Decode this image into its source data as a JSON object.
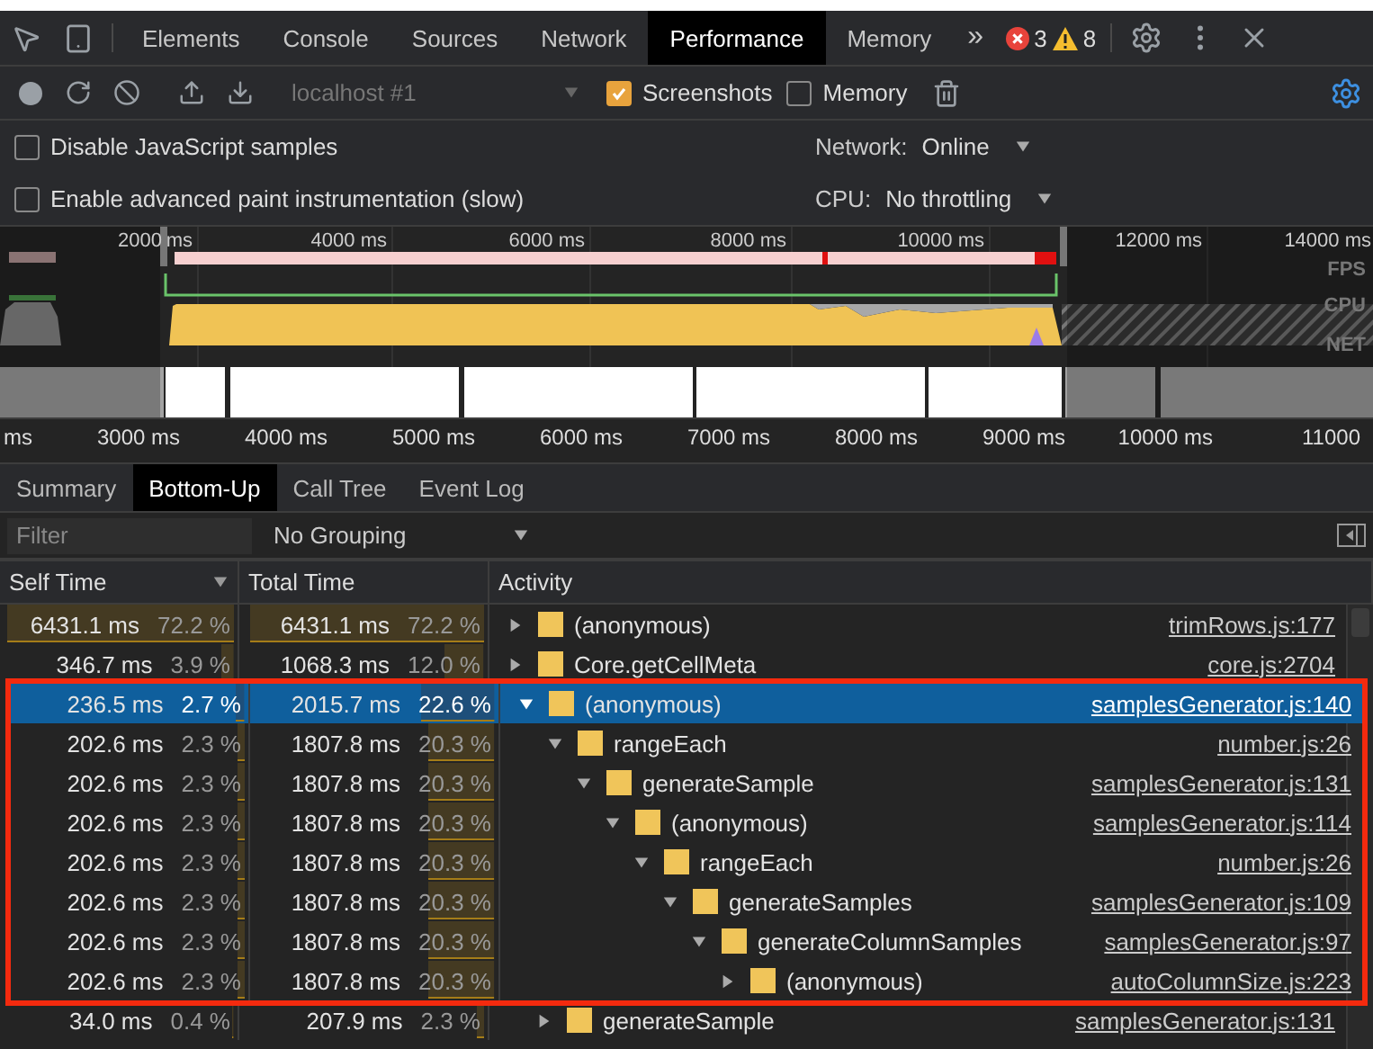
{
  "main_tabs": [
    {
      "label": "Elements",
      "selected": false
    },
    {
      "label": "Console",
      "selected": false
    },
    {
      "label": "Sources",
      "selected": false
    },
    {
      "label": "Network",
      "selected": false
    },
    {
      "label": "Performance",
      "selected": true
    },
    {
      "label": "Memory",
      "selected": false
    }
  ],
  "more_tabs": "»",
  "issues": {
    "errors": "3",
    "warnings": "8"
  },
  "toolbar": {
    "target": "localhost #1",
    "options": [
      {
        "label": "Screenshots",
        "checked": true
      },
      {
        "label": "Memory",
        "checked": false
      }
    ]
  },
  "settings": {
    "left": [
      {
        "label": "Disable JavaScript samples",
        "checked": false
      },
      {
        "label": "Enable advanced paint instrumentation (slow)",
        "checked": false
      }
    ],
    "right": [
      {
        "label": "Network:",
        "value": "Online"
      },
      {
        "label": "CPU:",
        "value": "No throttling"
      }
    ]
  },
  "overview": {
    "ruler": [
      "2000",
      "ms",
      "4000 ms",
      "6000 ms",
      "8000 ms",
      "10000 ms",
      "12000 ms",
      "14000 ms"
    ],
    "tracks": [
      "FPS",
      "CPU",
      "NET"
    ]
  },
  "timeline_ruler": [
    "ms",
    "3000 ms",
    "4000 ms",
    "5000 ms",
    "6000 ms",
    "7000 ms",
    "8000 ms",
    "9000 ms",
    "10000 ms",
    "11000"
  ],
  "detail_tabs": [
    {
      "label": "Summary",
      "selected": false
    },
    {
      "label": "Bottom-Up",
      "selected": true
    },
    {
      "label": "Call Tree",
      "selected": false
    },
    {
      "label": "Event Log",
      "selected": false
    }
  ],
  "filter": {
    "placeholder": "Filter"
  },
  "grouping": "No Grouping",
  "table": {
    "columns": [
      "Self Time",
      "Total Time",
      "Activity"
    ],
    "rows": [
      {
        "self_time": "6431.1 ms",
        "self_pct": "72.2 %",
        "total_time": "6431.1 ms",
        "total_pct": "72.2 %",
        "name": "(anonymous)",
        "source": "trimRows.js:177",
        "expanded": false,
        "selected": false,
        "highlighted": false
      },
      {
        "self_time": "346.7 ms",
        "self_pct": "3.9 %",
        "total_time": "1068.3 ms",
        "total_pct": "12.0 %",
        "name": "Core.getCellMeta",
        "source": "core.js:2704",
        "expanded": false,
        "selected": false,
        "highlighted": false
      },
      {
        "self_time": "236.5 ms",
        "self_pct": "2.7 %",
        "total_time": "2015.7 ms",
        "total_pct": "22.6 %",
        "name": "(anonymous)",
        "source": "samplesGenerator.js:140",
        "expanded": true,
        "selected": true,
        "highlighted": true,
        "children": [
          {
            "self_time": "202.6 ms",
            "self_pct": "2.3 %",
            "total_time": "1807.8 ms",
            "total_pct": "20.3 %",
            "name": "rangeEach",
            "source": "number.js:26",
            "expanded": true,
            "selected": false,
            "highlighted": true,
            "children": [
              {
                "self_time": "202.6 ms",
                "self_pct": "2.3 %",
                "total_time": "1807.8 ms",
                "total_pct": "20.3 %",
                "name": "generateSample",
                "source": "samplesGenerator.js:131",
                "expanded": true,
                "selected": false,
                "highlighted": true,
                "children": [
                  {
                    "self_time": "202.6 ms",
                    "self_pct": "2.3 %",
                    "total_time": "1807.8 ms",
                    "total_pct": "20.3 %",
                    "name": "(anonymous)",
                    "source": "samplesGenerator.js:114",
                    "expanded": true,
                    "selected": false,
                    "highlighted": true,
                    "children": [
                      {
                        "self_time": "202.6 ms",
                        "self_pct": "2.3 %",
                        "total_time": "1807.8 ms",
                        "total_pct": "20.3 %",
                        "name": "rangeEach",
                        "source": "number.js:26",
                        "expanded": true,
                        "selected": false,
                        "highlighted": true,
                        "children": [
                          {
                            "self_time": "202.6 ms",
                            "self_pct": "2.3 %",
                            "total_time": "1807.8 ms",
                            "total_pct": "20.3 %",
                            "name": "generateSamples",
                            "source": "samplesGenerator.js:109",
                            "expanded": true,
                            "selected": false,
                            "highlighted": true,
                            "children": [
                              {
                                "self_time": "202.6 ms",
                                "self_pct": "2.3 %",
                                "total_time": "1807.8 ms",
                                "total_pct": "20.3 %",
                                "name": "generateColumnSamples",
                                "source": "samplesGenerator.js:97",
                                "expanded": true,
                                "selected": false,
                                "highlighted": true,
                                "children": [
                                  {
                                    "self_time": "202.6 ms",
                                    "self_pct": "2.3 %",
                                    "total_time": "1807.8 ms",
                                    "total_pct": "20.3 %",
                                    "name": "(anonymous)",
                                    "source": "autoColumnSize.js:223",
                                    "expanded": false,
                                    "selected": false,
                                    "highlighted": true
                                  }
                                ]
                              }
                            ]
                          }
                        ]
                      }
                    ]
                  }
                ]
              }
            ]
          },
          {
            "self_time": "34.0 ms",
            "self_pct": "0.4 %",
            "total_time": "207.9 ms",
            "total_pct": "2.3 %",
            "name": "generateSample",
            "source": "samplesGenerator.js:131",
            "expanded": false,
            "selected": false,
            "highlighted": false
          }
        ]
      }
    ]
  }
}
